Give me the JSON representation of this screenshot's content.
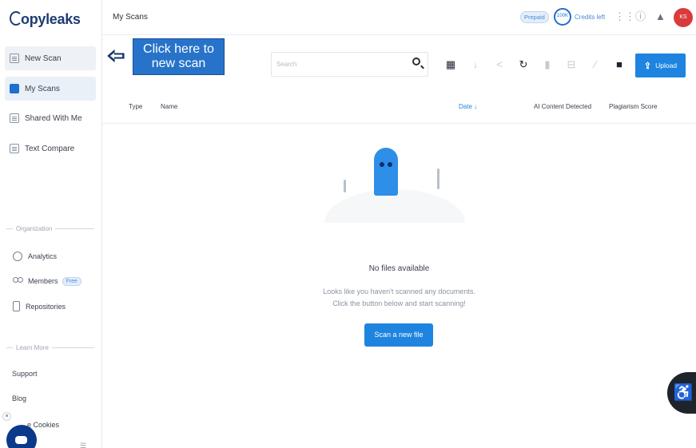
{
  "app": {
    "logo": "opyleaks",
    "logo_c": "C"
  },
  "sidebar": {
    "items": [
      {
        "label": "New Scan"
      },
      {
        "label": "My Scans"
      },
      {
        "label": "Shared With Me"
      },
      {
        "label": "Text Compare"
      }
    ],
    "organization_label": "Organization",
    "org_items": [
      {
        "label": "Analytics"
      },
      {
        "label": "Members",
        "badge": "Free"
      },
      {
        "label": "Repositories"
      }
    ],
    "learn_more_label": "Learn More",
    "links": [
      {
        "label": "Support"
      },
      {
        "label": "Blog"
      },
      {
        "label": "e Cookies"
      }
    ]
  },
  "topbar": {
    "breadcrumb": "My Scans",
    "prepaid": "Prepaid",
    "credits_value": "100K",
    "credits_label": "Credits left",
    "avatar_initials": "KS"
  },
  "toolbar": {
    "search_placeholder": "Search",
    "upload_label": "Upload"
  },
  "table": {
    "headers": {
      "type": "Type",
      "name": "Name",
      "date": "Date ↓",
      "ai": "AI Content Detected",
      "plagiarism": "Plagiarism Score"
    }
  },
  "empty_state": {
    "title": "No files available",
    "line1": "Looks like you haven't scanned any documents.",
    "line2": "Click the button below and start scanning!",
    "button": "Scan a new file"
  },
  "annotation": {
    "line1": "Click here to",
    "line2": "new scan"
  },
  "colors": {
    "accent": "#1e84e0",
    "tooltip": "#2773c9",
    "avatar": "#d93b3b",
    "ghost": "#2e8fe8"
  }
}
